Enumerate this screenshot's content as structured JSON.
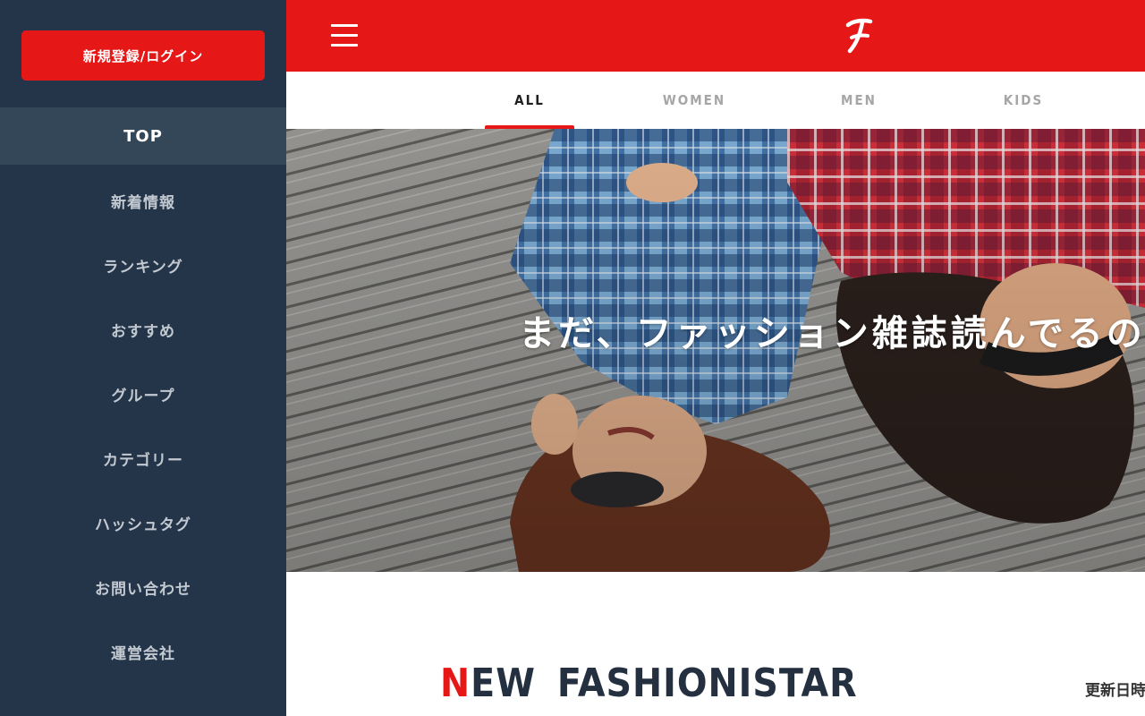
{
  "sidebar": {
    "login_label": "新規登録/ログイン",
    "items": [
      {
        "label": "TOP",
        "active": true
      },
      {
        "label": "新着情報"
      },
      {
        "label": "ランキング"
      },
      {
        "label": "おすすめ"
      },
      {
        "label": "グループ"
      },
      {
        "label": "カテゴリー"
      },
      {
        "label": "ハッシュタグ"
      },
      {
        "label": "お問い合わせ"
      },
      {
        "label": "運営会社"
      }
    ]
  },
  "header": {
    "logo_letter": "F",
    "icons": [
      "hamburger-menu-icon",
      "brand-logo-icon"
    ]
  },
  "tabs": [
    {
      "label": "ALL",
      "active": true
    },
    {
      "label": "WOMEN"
    },
    {
      "label": "MEN"
    },
    {
      "label": "KIDS"
    }
  ],
  "hero": {
    "headline": "まだ、ファッション雑誌読んでるの"
  },
  "section": {
    "title_first_letter": "N",
    "title_rest": "EW",
    "title_second": "FASHIONISTAR",
    "updated_label": "更新日時"
  },
  "colors": {
    "accent": "#e61717",
    "sidebar": "#243549",
    "sidebar_active": "#344758"
  }
}
